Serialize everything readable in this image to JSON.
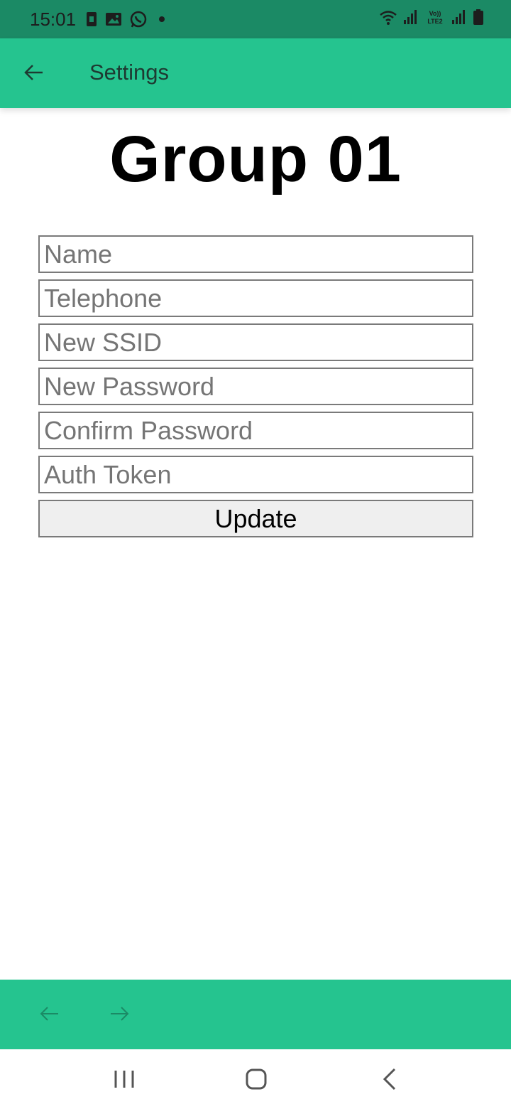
{
  "status_bar": {
    "time": "15:01",
    "left_icons": [
      "sim-icon",
      "gallery-icon",
      "whatsapp-icon",
      "dot-icon"
    ],
    "right_icons": [
      "wifi-icon",
      "signal-icon",
      "volte-icon",
      "signal-icon",
      "battery-icon"
    ],
    "volte_label": "Vo)) LTE2"
  },
  "app_bar": {
    "title": "Settings"
  },
  "main": {
    "title": "Group 01",
    "fields": {
      "name": "Name",
      "telephone": "Telephone",
      "ssid": "New SSID",
      "password": "New Password",
      "confirm": "Confirm Password",
      "token": "Auth Token"
    },
    "update_label": "Update"
  },
  "colors": {
    "accent": "#25c48f",
    "status_bar": "#1b8a65"
  }
}
